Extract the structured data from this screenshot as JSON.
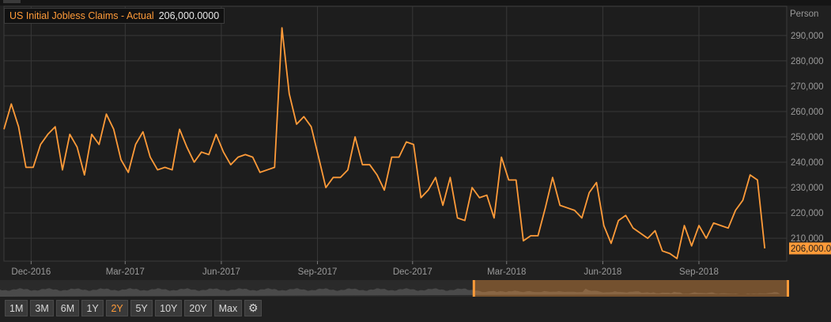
{
  "chart_data": {
    "type": "line",
    "title": "US Initial Jobless Claims - Actual",
    "last_value_label": "206,000.0000",
    "last_marker_label": "206,000.0",
    "unit_label": "Person",
    "color": "#ff9b39",
    "ylim": [
      201000,
      301500
    ],
    "yticks": [
      210000,
      220000,
      230000,
      240000,
      250000,
      260000,
      270000,
      280000,
      290000
    ],
    "ytick_labels": [
      "210,000",
      "220,000",
      "230,000",
      "240,000",
      "250,000",
      "260,000",
      "270,000",
      "280,000",
      "290,000"
    ],
    "x_start": "2016-11-05",
    "x_end": "2018-11-24",
    "xticks": [
      "2016-12-01",
      "2017-03-01",
      "2017-06-01",
      "2017-09-01",
      "2017-12-01",
      "2018-03-01",
      "2018-06-01",
      "2018-09-01"
    ],
    "xtick_labels": [
      "Dec-2016",
      "Mar-2017",
      "Jun-2017",
      "Sep-2017",
      "Dec-2017",
      "Mar-2018",
      "Jun-2018",
      "Sep-2018"
    ],
    "x": [
      "2016-11-05",
      "2016-11-12",
      "2016-11-19",
      "2016-11-26",
      "2016-12-03",
      "2016-12-10",
      "2016-12-17",
      "2016-12-24",
      "2016-12-31",
      "2017-01-07",
      "2017-01-14",
      "2017-01-21",
      "2017-01-28",
      "2017-02-04",
      "2017-02-11",
      "2017-02-18",
      "2017-02-25",
      "2017-03-04",
      "2017-03-11",
      "2017-03-18",
      "2017-03-25",
      "2017-04-01",
      "2017-04-08",
      "2017-04-15",
      "2017-04-22",
      "2017-04-29",
      "2017-05-06",
      "2017-05-13",
      "2017-05-20",
      "2017-05-27",
      "2017-06-03",
      "2017-06-10",
      "2017-06-17",
      "2017-06-24",
      "2017-07-01",
      "2017-07-08",
      "2017-07-15",
      "2017-07-22",
      "2017-07-29",
      "2017-08-05",
      "2017-08-12",
      "2017-08-19",
      "2017-08-26",
      "2017-09-02",
      "2017-09-09",
      "2017-09-16",
      "2017-09-23",
      "2017-09-30",
      "2017-10-07",
      "2017-10-14",
      "2017-10-21",
      "2017-10-28",
      "2017-11-04",
      "2017-11-11",
      "2017-11-18",
      "2017-11-25",
      "2017-12-02",
      "2017-12-09",
      "2017-12-16",
      "2017-12-23",
      "2017-12-30",
      "2018-01-06",
      "2018-01-13",
      "2018-01-20",
      "2018-01-27",
      "2018-02-03",
      "2018-02-10",
      "2018-02-17",
      "2018-02-24",
      "2018-03-03",
      "2018-03-10",
      "2018-03-17",
      "2018-03-24",
      "2018-03-31",
      "2018-04-07",
      "2018-04-14",
      "2018-04-21",
      "2018-04-28",
      "2018-05-05",
      "2018-05-12",
      "2018-05-19",
      "2018-05-26",
      "2018-06-02",
      "2018-06-09",
      "2018-06-16",
      "2018-06-23",
      "2018-06-30",
      "2018-07-07",
      "2018-07-14",
      "2018-07-21",
      "2018-07-28",
      "2018-08-04",
      "2018-08-11",
      "2018-08-18",
      "2018-08-25",
      "2018-09-01",
      "2018-09-08",
      "2018-09-15",
      "2018-09-22",
      "2018-09-29",
      "2018-10-06",
      "2018-10-13",
      "2018-10-20",
      "2018-10-27",
      "2018-11-03",
      "2018-11-10",
      "2018-11-17"
    ],
    "values": [
      253000,
      263000,
      254000,
      238000,
      238000,
      247000,
      251000,
      254000,
      237000,
      251000,
      246000,
      235000,
      251000,
      247000,
      259000,
      253000,
      241000,
      236000,
      247000,
      252000,
      242000,
      237000,
      238000,
      237000,
      253000,
      246000,
      240000,
      244000,
      243000,
      251000,
      244000,
      239000,
      242000,
      243000,
      242000,
      236000,
      237000,
      238000,
      293000,
      267000,
      255000,
      258000,
      254000,
      242000,
      230000,
      234000,
      234000,
      237000,
      250000,
      239000,
      239000,
      235000,
      229000,
      242000,
      242000,
      248000,
      247000,
      226000,
      229000,
      234000,
      223000,
      234000,
      218000,
      217000,
      230000,
      226000,
      227000,
      218000,
      242000,
      233000,
      233000,
      209000,
      211000,
      211000,
      222000,
      234000,
      223000,
      222000,
      221000,
      218000,
      228000,
      232000,
      215000,
      208000,
      217000,
      219000,
      214000,
      212000,
      210000,
      213000,
      205000,
      204000,
      202000,
      215000,
      207000,
      215000,
      210000,
      216000,
      215000,
      214000,
      221000,
      225000,
      235000,
      233000,
      206000
    ]
  },
  "navigator": {
    "selection_start_fraction": 0.6
  },
  "range_buttons": [
    {
      "label": "1M",
      "active": false
    },
    {
      "label": "3M",
      "active": false
    },
    {
      "label": "6M",
      "active": false
    },
    {
      "label": "1Y",
      "active": false
    },
    {
      "label": "2Y",
      "active": true
    },
    {
      "label": "5Y",
      "active": false
    },
    {
      "label": "10Y",
      "active": false
    },
    {
      "label": "20Y",
      "active": false
    },
    {
      "label": "Max",
      "active": false
    }
  ],
  "settings_icon": "gear-icon"
}
